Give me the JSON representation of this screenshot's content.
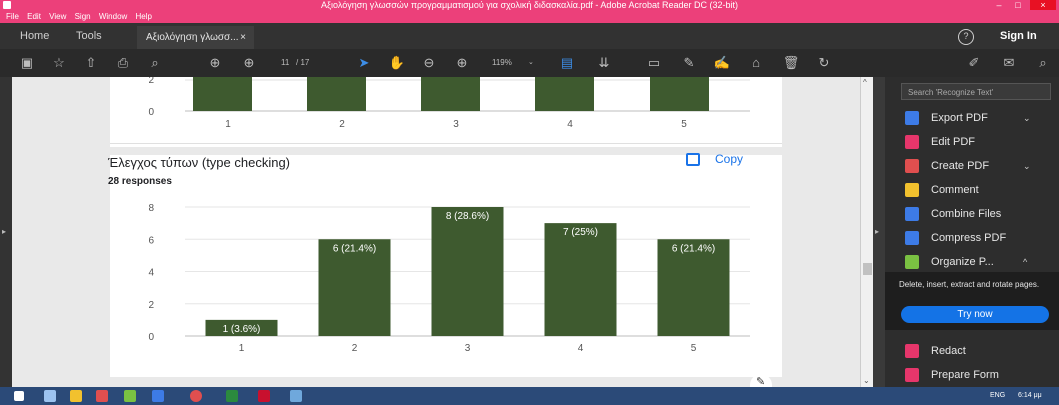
{
  "window": {
    "title": "Αξιολόγηση γλωσσών προγραμματισμού για σχολική διδασκαλία.pdf - Adobe Acrobat Reader DC (32-bit)",
    "minimize_label": "–",
    "maximize_label": "□",
    "close_label": "×"
  },
  "menu": {
    "items": [
      "File",
      "Edit",
      "View",
      "Sign",
      "Window",
      "Help"
    ]
  },
  "tabs": {
    "home": "Home",
    "tools": "Tools",
    "document": "Αξιολόγηση γλωσσ...",
    "document_close": "×",
    "help_icon": "?",
    "sign_in": "Sign In"
  },
  "toolbar": {
    "page_current": "11",
    "page_total": "/ 17",
    "zoom": "119%"
  },
  "page": {
    "top_chart": {
      "tick_labels_y": [
        "0",
        "2"
      ],
      "categories": [
        "1",
        "2",
        "3",
        "4",
        "5"
      ]
    },
    "question": {
      "title": "Έλεγχος τύπων (type checking)",
      "responses": "28 responses",
      "copy_label": "Copy"
    }
  },
  "chart_data": {
    "type": "bar",
    "title": "Έλεγχος τύπων (type checking)",
    "categories": [
      "1",
      "2",
      "3",
      "4",
      "5"
    ],
    "values": [
      1,
      6,
      8,
      7,
      6
    ],
    "data_labels": [
      "1 (3.6%)",
      "6 (21.4%)",
      "8 (28.6%)",
      "7 (25%)",
      "6 (21.4%)"
    ],
    "ylim": [
      0,
      8
    ],
    "yticks": [
      "0",
      "2",
      "4",
      "6",
      "8"
    ],
    "bar_color": "#3e5a2f",
    "grid": true
  },
  "right_panel": {
    "search_placeholder": "Search 'Recognize Text'",
    "items": [
      {
        "label": "Export PDF",
        "icon": "export-pdf-icon",
        "color": "#3d7be6",
        "expand": "⌄"
      },
      {
        "label": "Edit PDF",
        "icon": "edit-pdf-icon",
        "color": "#e6366b",
        "expand": ""
      },
      {
        "label": "Create PDF",
        "icon": "create-pdf-icon",
        "color": "#e04f4f",
        "expand": "⌄"
      },
      {
        "label": "Comment",
        "icon": "comment-icon",
        "color": "#f2c12e",
        "expand": ""
      },
      {
        "label": "Combine Files",
        "icon": "combine-files-icon",
        "color": "#3d7be6",
        "expand": ""
      },
      {
        "label": "Compress PDF",
        "icon": "compress-pdf-icon",
        "color": "#3d7be6",
        "expand": ""
      },
      {
        "label": "Organize P...",
        "icon": "organize-pages-icon",
        "color": "#7ac142",
        "expand": "^"
      }
    ],
    "organize_description": "Delete, insert, extract and rotate pages.",
    "try_now": "Try now",
    "bottom_items": [
      {
        "label": "Redact",
        "icon": "redact-icon",
        "color": "#e6366b"
      },
      {
        "label": "Prepare Form",
        "icon": "prepare-form-icon",
        "color": "#e6366b"
      }
    ]
  },
  "taskbar": {
    "language": "ENG",
    "time": "6:14 μμ"
  }
}
